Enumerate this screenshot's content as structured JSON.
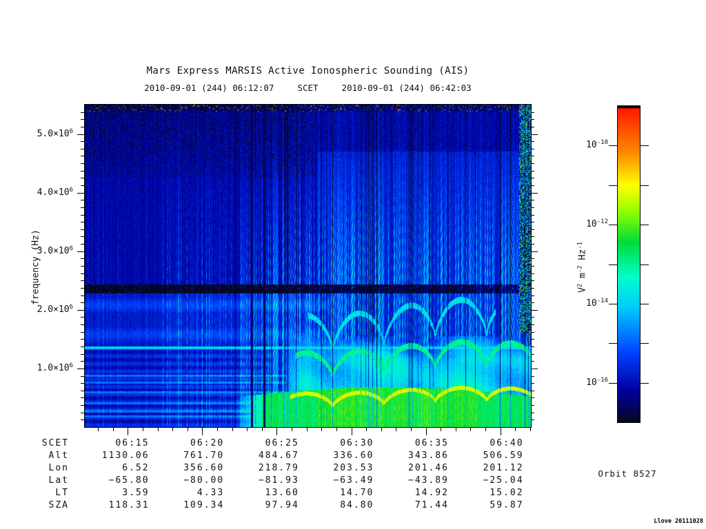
{
  "stamp": "Llove 20111028",
  "chart_data": {
    "type": "heatmap",
    "title": "Mars Express MARSIS Active Ionospheric Sounding (AIS)",
    "orbit_label": "Orbit 8527",
    "x": {
      "label": "SCET",
      "scet_word": "SCET",
      "start_label": "2010-09-01 (244) 06:12:07",
      "end_label": "2010-09-01 (244) 06:42:03",
      "start_min": 12.1167,
      "end_min": 42.05,
      "major_ticks": [
        "06:15",
        "06:20",
        "06:25",
        "06:30",
        "06:35",
        "06:40"
      ],
      "major_tick_minutes": [
        15,
        20,
        25,
        30,
        35,
        40
      ],
      "minor_tick_step_min": 1
    },
    "y": {
      "label": "frequency (Hz)",
      "range_mhz": [
        0,
        5.5
      ],
      "tick_labels": [
        {
          "base": "1.0×10",
          "exp": "6",
          "mhz": 1.0
        },
        {
          "base": "2.0×10",
          "exp": "6",
          "mhz": 2.0
        },
        {
          "base": "3.0×10",
          "exp": "6",
          "mhz": 3.0
        },
        {
          "base": "4.0×10",
          "exp": "6",
          "mhz": 4.0
        },
        {
          "base": "5.0×10",
          "exp": "6",
          "mhz": 5.0
        }
      ],
      "minor_tick_step_mhz": 0.125
    },
    "z": {
      "scale": "log10",
      "range_decades": [
        -17,
        -9
      ],
      "unit_segments": [
        {
          "t": "V"
        },
        {
          "t": "2",
          "sup": true
        },
        {
          "t": " m"
        },
        {
          "t": "-2",
          "sup": true
        },
        {
          "t": " Hz"
        },
        {
          "t": "-1",
          "sup": true
        }
      ],
      "tick_decades": [
        -10,
        -11,
        -12,
        -13,
        -14,
        -15,
        -16
      ],
      "tick_labels": [
        {
          "base": "10",
          "exp": "-10",
          "decade": -10
        },
        {
          "base": "10",
          "exp": "-12",
          "decade": -12
        },
        {
          "base": "10",
          "exp": "-14",
          "decade": -14
        },
        {
          "base": "10",
          "exp": "-16",
          "decade": -16
        }
      ]
    },
    "colormap_stops": [
      [
        0.0,
        "#06061e"
      ],
      [
        0.1,
        "#0000a0"
      ],
      [
        0.22,
        "#0040ff"
      ],
      [
        0.36,
        "#00c8ff"
      ],
      [
        0.46,
        "#00ffc8"
      ],
      [
        0.57,
        "#00dc3c"
      ],
      [
        0.67,
        "#96ff00"
      ],
      [
        0.75,
        "#ffff00"
      ],
      [
        0.85,
        "#ff8c00"
      ],
      [
        1.0,
        "#ff1400"
      ]
    ],
    "ephemeris": {
      "row_labels": [
        "SCET",
        "Alt",
        "Lon",
        "Lat",
        "LT",
        "SZA"
      ],
      "columns": [
        "06:15",
        "06:20",
        "06:25",
        "06:30",
        "06:35",
        "06:40"
      ],
      "rows": {
        "Alt": [
          "1130.06",
          "761.70",
          "484.67",
          "336.60",
          "343.86",
          "506.59"
        ],
        "Lon": [
          "6.52",
          "356.60",
          "218.79",
          "203.53",
          "201.46",
          "201.12"
        ],
        "Lat": [
          "−65.80",
          "−80.00",
          "−81.93",
          "−63.49",
          "−43.89",
          "−25.04"
        ],
        "LT": [
          "3.59",
          "4.33",
          "13.60",
          "14.70",
          "14.92",
          "15.02"
        ],
        "SZA": [
          "118.31",
          "109.34",
          "97.94",
          "84.80",
          "71.44",
          "59.87"
        ]
      }
    },
    "features": {
      "seed": 8527,
      "background_decade": -16.15,
      "black_band_mhz": [
        2.28,
        2.43
      ],
      "interference_line_mhz": 1.355,
      "interference_line_decade": -14.0,
      "harmonic_lines_mhz": [
        0.18,
        0.27,
        0.41,
        0.59,
        0.76,
        0.88
      ],
      "speckle_zone_min_mhz": 4.25,
      "upper_right_patch": {
        "start_frac": 0.52,
        "max_mhz": 4.7,
        "boost": 0.35
      },
      "stripe_regions": [
        {
          "until_frac": 0.17,
          "amp": 0.7,
          "density": 0.1
        },
        {
          "until_frac": 0.38,
          "amp": 1.5,
          "density": 0.33
        },
        {
          "until_frac": 1.01,
          "amp": 2.2,
          "density": 0.5
        }
      ],
      "dark_column_gaps_frac": [
        0.374,
        0.402
      ],
      "right_noise_start_frac": 0.973,
      "echo": {
        "region_start_frac": 0.44,
        "max_mhz": 1.55,
        "base_decade": -14.1,
        "mound_base_mhz": 0.48,
        "mound_amp_mhz": 0.2,
        "mound_decade": -12.8,
        "hot_decade_boost": 0.35,
        "hot_range_frac": [
          0.52,
          0.88
        ],
        "band_start_frac": 0.335
      },
      "trace": {
        "start_frac": 0.46,
        "base_mhz": 0.4,
        "arc_amp_mhz": 0.22,
        "arc_period_frac": 0.115,
        "wobble_mhz": 0.05,
        "decade": -11.2,
        "h2_decade": -13.0,
        "h3_decade": -13.8
      }
    }
  }
}
